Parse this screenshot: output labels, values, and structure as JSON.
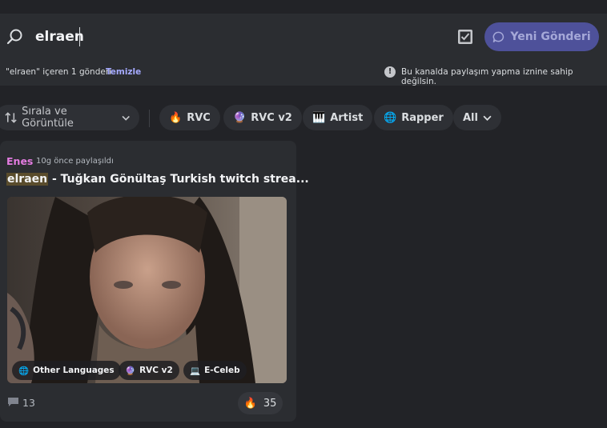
{
  "search": {
    "query": "elraen",
    "new_post_label": "Yeni Gönderi"
  },
  "info": {
    "result_text": "\"elraen\" içeren 1 gönderi",
    "clear_label": "Temizle",
    "warning_text": "Bu kanalda paylaşım yapma iznine sahip değilsin."
  },
  "filters": {
    "sort_label": "Sırala ve Görüntüle",
    "tags": [
      {
        "emoji": "🔥",
        "label": "RVC"
      },
      {
        "emoji": "🔮",
        "label": "RVC v2"
      },
      {
        "emoji": "🎹",
        "label": "Artist"
      },
      {
        "emoji": "🌐",
        "label": "Rapper"
      },
      {
        "emoji": "",
        "label": "All"
      }
    ]
  },
  "post": {
    "author": "Enes",
    "time": "10g önce paylaşıldı",
    "title_highlight": "elraen",
    "title_rest": " - Tuğkan Gönültaş Turkish twitch strea...",
    "image_tags": [
      {
        "emoji": "🌐",
        "label": "Other Languages"
      },
      {
        "emoji": "🔮",
        "label": "RVC v2"
      },
      {
        "emoji": "💻",
        "label": "E-Celeb"
      }
    ],
    "comment_count": "13",
    "reaction_emoji": "🔥",
    "reaction_count": "35"
  }
}
